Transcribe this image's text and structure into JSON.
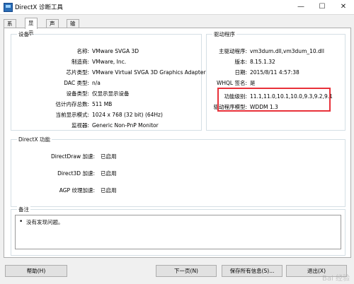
{
  "window": {
    "title": "DirectX 诊断工具",
    "controls": {
      "minimize": "—",
      "maximize": "☐",
      "close": "✕"
    }
  },
  "tabs": [
    {
      "label": "系统",
      "active": false
    },
    {
      "label": "显示",
      "active": true
    },
    {
      "label": "声音",
      "active": false
    },
    {
      "label": "输入",
      "active": false
    }
  ],
  "device": {
    "title": "设备",
    "rows": [
      {
        "label": "名称:",
        "value": "VMware SVGA 3D"
      },
      {
        "label": "制造商:",
        "value": "VMware, Inc."
      },
      {
        "label": "芯片类型:",
        "value": "VMware Virtual SVGA 3D Graphics Adapter"
      },
      {
        "label": "DAC 类型:",
        "value": "n/a"
      },
      {
        "label": "设备类型:",
        "value": "仅显示显示设备"
      },
      {
        "label": "估计内存总数:",
        "value": "511 MB"
      },
      {
        "label": "当前显示模式:",
        "value": "1024 x 768 (32 bit) (64Hz)"
      },
      {
        "label": "监视器:",
        "value": "Generic Non-PnP Monitor"
      }
    ]
  },
  "driver": {
    "title": "驱动程序",
    "rows": [
      {
        "label": "主驱动程序:",
        "value": "vm3dum.dll,vm3dum_10.dll"
      },
      {
        "label": "版本:",
        "value": "8.15.1.32"
      },
      {
        "label": "日期:",
        "value": "2015/8/11 4:57:38"
      },
      {
        "label": "WHQL 签名:",
        "value": "是"
      },
      {
        "label": "功能级别:",
        "value": "11.1,11.0,10.1,10.0,9.3,9.2,9.1"
      },
      {
        "label": "驱动程序模型:",
        "value": "WDDM 1.3"
      }
    ],
    "highlight_color": "#e8313a"
  },
  "directx": {
    "title": "DirectX 功能",
    "rows": [
      {
        "label": "DirectDraw 加速:",
        "value": "已启用"
      },
      {
        "label": "Direct3D 加速:",
        "value": "已启用"
      },
      {
        "label": "AGP 纹理加速:",
        "value": "已启用"
      }
    ]
  },
  "notes": {
    "title": "备注",
    "bullet": "•",
    "items": [
      "没有发现问题。"
    ]
  },
  "footer": {
    "help": "帮助(H)",
    "next": "下一页(N)",
    "save": "保存所有信息(S)...",
    "exit": "退出(X)"
  },
  "watermark": "Bai 经验"
}
